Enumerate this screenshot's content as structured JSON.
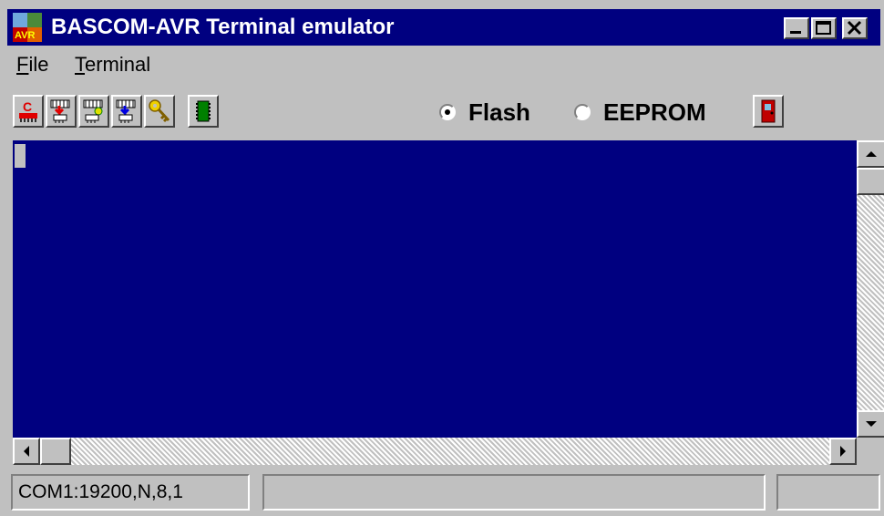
{
  "window": {
    "title": "BASCOM-AVR Terminal emulator",
    "title_bar_color": "#000080",
    "app_icon": "bascom-avr-logo-icon",
    "controls": [
      "minimize-icon",
      "maximize-icon",
      "close-icon"
    ]
  },
  "menu": {
    "items": [
      {
        "label": "File",
        "accel": "F",
        "rest": "ile"
      },
      {
        "label": "Terminal",
        "accel": "T",
        "rest": "erminal"
      }
    ]
  },
  "toolbar": {
    "tools": [
      {
        "icon": "chip-clear-icon"
      },
      {
        "icon": "chip-write-icon"
      },
      {
        "icon": "chip-read-icon"
      },
      {
        "icon": "chip-program-icon"
      },
      {
        "icon": "key-icon"
      },
      {
        "icon": "memory-icon"
      }
    ],
    "radios": [
      {
        "label": "Flash",
        "selected": true
      },
      {
        "label": "EEPROM",
        "selected": false
      }
    ],
    "exit_icon": "exit-door-icon"
  },
  "terminal": {
    "background": "#000080",
    "content": ""
  },
  "status": {
    "port": "COM1:19200,N,8,1",
    "middle": "",
    "right": ""
  }
}
